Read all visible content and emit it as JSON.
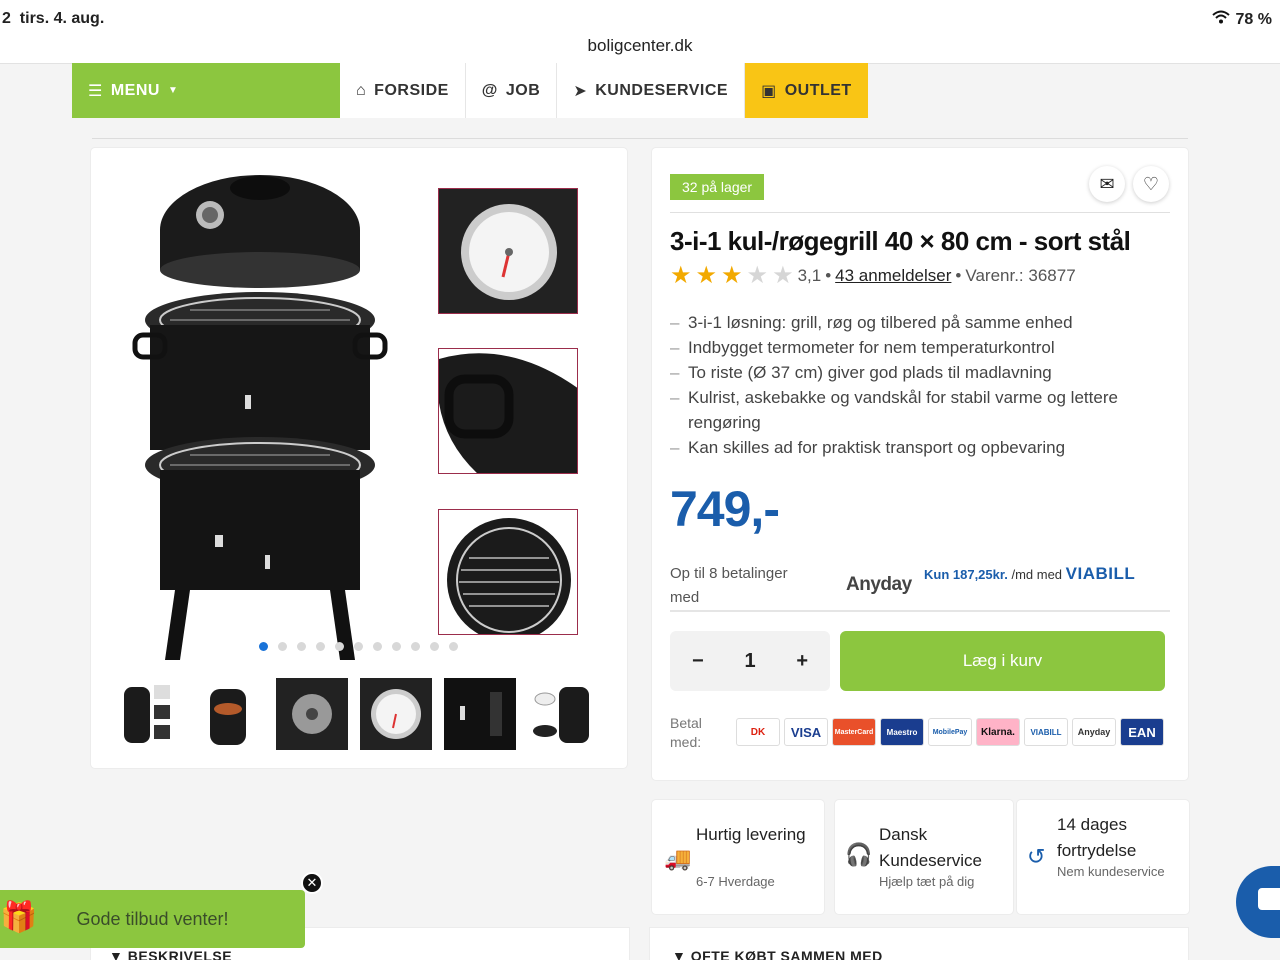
{
  "status": {
    "time": "2",
    "date": "tirs. 4. aug.",
    "battery": "78 %"
  },
  "browser": {
    "url": "boligcenter.dk"
  },
  "nav": {
    "menu": "MENU",
    "items": [
      {
        "label": "FORSIDE",
        "icon": "home-icon"
      },
      {
        "label": "JOB",
        "icon": "at-icon"
      },
      {
        "label": "KUNDESERVICE",
        "icon": "paper-plane-icon"
      },
      {
        "label": "OUTLET",
        "icon": "archive-icon"
      }
    ]
  },
  "product": {
    "stock": "32 på lager",
    "title": "3-i-1 kul-/røgegrill 40 × 80 cm - sort stål",
    "rating": 3.1,
    "rating_text": "3,1",
    "separator": "•",
    "reviews": "43 anmeldelser",
    "sku": "Varenr.: 36877",
    "bullets": [
      "3-i-1 løsning: grill, røg og tilbered på samme enhed",
      "Indbygget termometer for nem temperaturkontrol",
      "To riste (Ø 37 cm) giver god plads til madlavning",
      "Kulrist, askebakke og vandskål for stabil varme og lettere rengøring",
      "Kan skilles ad for praktisk transport og opbevaring"
    ],
    "price": "749,-",
    "installments_text": "Op til 8 betalinger med",
    "anyday": "Anyday",
    "viabill_prefix": "Kun 187,25kr.",
    "viabill_mid": "/md med",
    "viabill_brand": "VIABILL",
    "quantity": "1",
    "minus": "−",
    "plus": "+",
    "add_to_cart": "Læg i kurv",
    "pay_with": "Betal med:",
    "payment_methods": [
      "DK",
      "VISA",
      "MasterCard",
      "Maestro",
      "MobilePay",
      "Klarna.",
      "VIABILL",
      "Anyday",
      "EAN"
    ]
  },
  "gallery": {
    "dots": 11,
    "active_dot": 0
  },
  "usps": [
    {
      "title": "Hurtig levering",
      "sub": "6-7 Hverdage",
      "icon": "truck-icon"
    },
    {
      "title": "Dansk Kundeservice",
      "sub": "Hjælp tæt på dig",
      "icon": "headset-icon"
    },
    {
      "title": "14 dages fortrydelse",
      "sub": "Nem kundeservice",
      "icon": "return-icon"
    }
  ],
  "bottom": {
    "description": "▼ BESKRIVELSE",
    "bought_together": "▼ OFTE KØBT SAMMEN MED"
  },
  "toast": {
    "text": "Gode tilbud venter!"
  },
  "colors": {
    "green": "#8cc63f",
    "yellow": "#f9c515",
    "blue": "#1a5dab"
  }
}
